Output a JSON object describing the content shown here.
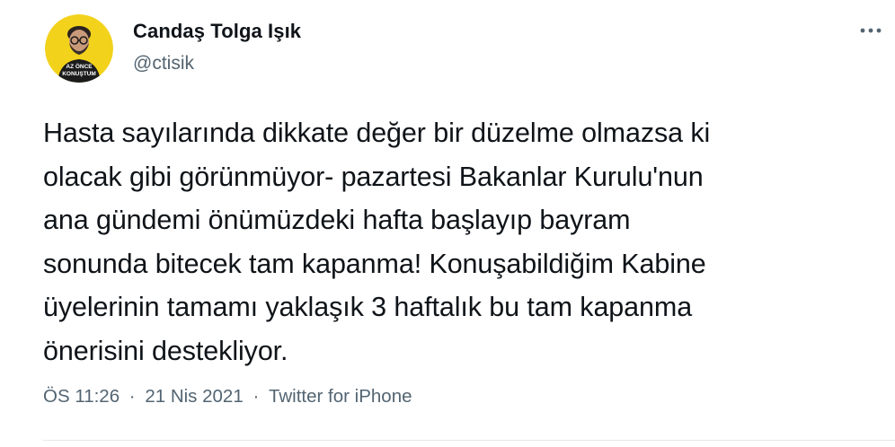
{
  "author": {
    "display_name": "Candaş Tolga Işık",
    "handle": "@ctisik",
    "avatar_icon": "person-avatar",
    "avatar_text_line1": "AZ ÖNCE",
    "avatar_text_line2": "KONUŞTUM"
  },
  "menu": {
    "icon": "more-dots-icon"
  },
  "tweet": {
    "text": "Hasta sayılarında dikkate değer bir düzelme olmazsa ki\nolacak gibi görünmüyor- pazartesi Bakanlar Kurulu'nun\nana gündemi önümüzdeki hafta başlayıp bayram\nsonunda bitecek tam kapanma! Konuşabildiğim Kabine\nüyelerinin tamamı yaklaşık 3 haftalık bu tam kapanma\nönerisini destekliyor."
  },
  "meta": {
    "time": "ÖS 11:26",
    "separator": "·",
    "date": "21 Nis 2021",
    "source": "Twitter for iPhone"
  },
  "colors": {
    "text": "#0f1419",
    "secondary": "#536471",
    "avatar_bg": "#f2d21b",
    "divider": "#e7e9ea"
  }
}
